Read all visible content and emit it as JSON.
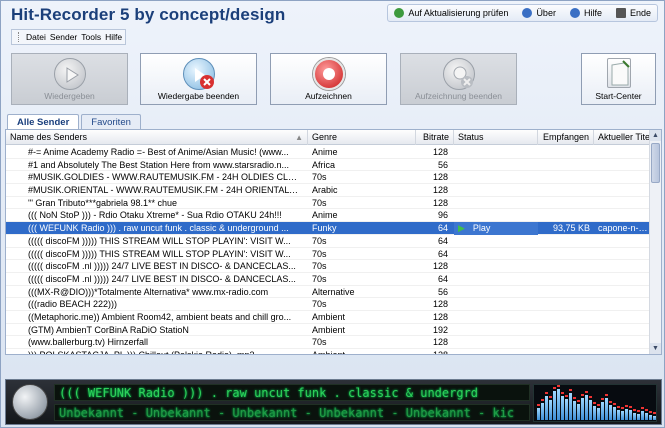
{
  "app": {
    "title": "Hit-Recorder 5 by concept/design"
  },
  "toplinks": [
    {
      "label": "Auf Aktualisierung prüfen",
      "color": "#3d9a3d"
    },
    {
      "label": "Über",
      "color": "#3a6fc4"
    },
    {
      "label": "Hilfe",
      "color": "#3a6fc4"
    },
    {
      "label": "Ende",
      "color": "#444444"
    }
  ],
  "menu": [
    "Datei",
    "Sender",
    "Tools",
    "Hilfe"
  ],
  "toolbar": {
    "play": "Wiedergeben",
    "stop_play": "Wiedergabe beenden",
    "record": "Aufzeichnen",
    "stop_record": "Aufzeichnung beenden",
    "start_center": "Start-Center"
  },
  "tabs": [
    "Alle Sender",
    "Favoriten"
  ],
  "columns": {
    "name": "Name des Senders",
    "genre": "Genre",
    "bitrate": "Bitrate",
    "status": "Status",
    "received": "Empfangen",
    "title": "Aktueller Tite"
  },
  "rows": [
    {
      "name": "#-= Anime Academy Radio =- Best of Anime/Asian Music! (www...",
      "genre": "Anime",
      "bitrate": "128",
      "status": "",
      "received": "",
      "title": ""
    },
    {
      "name": "#1 and Absolutely The Best Station Here from www.starsradio.n...",
      "genre": "Africa",
      "bitrate": "56",
      "status": "",
      "received": "",
      "title": ""
    },
    {
      "name": "#MUSIK.GOLDIES - WWW.RAUTEMUSIK.FM - 24H OLDIES CLAS...",
      "genre": "70s",
      "bitrate": "128",
      "status": "",
      "received": "",
      "title": ""
    },
    {
      "name": "#MUSIK.ORIENTAL - WWW.RAUTEMUSIK.FM - 24H ORIENTAL A...",
      "genre": "Arabic",
      "bitrate": "128",
      "status": "",
      "received": "",
      "title": ""
    },
    {
      "name": "'\" Gran Tributo***gabriela 98.1** chue",
      "genre": "70s",
      "bitrate": "128",
      "status": "",
      "received": "",
      "title": ""
    },
    {
      "name": "((( NoN StoP ))) - Rdio Otaku Xtreme* - Sua Rdio OTAKU 24h!!!",
      "genre": "Anime",
      "bitrate": "96",
      "status": "",
      "received": "",
      "title": ""
    },
    {
      "name": "((( WEFUNK Radio ))) . raw uncut funk . classic & underground ...",
      "genre": "Funky",
      "bitrate": "64",
      "status": "Play",
      "received": "93,75 KB",
      "title": "capone-n-nore",
      "selected": true
    },
    {
      "name": "((((( discoFM ))))) THIS STREAM WILL STOP PLAYIN': VISIT W...",
      "genre": "70s",
      "bitrate": "64",
      "status": "",
      "received": "",
      "title": ""
    },
    {
      "name": "((((( discoFM ))))) THIS STREAM WILL STOP PLAYIN': VISIT W...",
      "genre": "70s",
      "bitrate": "64",
      "status": "",
      "received": "",
      "title": ""
    },
    {
      "name": "((((( discoFM .nl ))))) 24/7 LIVE BEST IN DISCO- & DANCECLAS...",
      "genre": "70s",
      "bitrate": "128",
      "status": "",
      "received": "",
      "title": ""
    },
    {
      "name": "((((( discoFM .nl ))))) 24/7 LIVE BEST IN DISCO- & DANCECLAS...",
      "genre": "70s",
      "bitrate": "64",
      "status": "",
      "received": "",
      "title": ""
    },
    {
      "name": "(((MX-R@DIO)))*Totalmente Alternativa* www.mx-radio.com",
      "genre": "Alternative",
      "bitrate": "56",
      "status": "",
      "received": "",
      "title": ""
    },
    {
      "name": "(((radio BEACH 222)))",
      "genre": "70s",
      "bitrate": "128",
      "status": "",
      "received": "",
      "title": ""
    },
    {
      "name": "((Metaphoric.me)) Ambient Room42, ambient beats and chill gro...",
      "genre": "Ambient",
      "bitrate": "128",
      "status": "",
      "received": "",
      "title": ""
    },
    {
      "name": "(GTM) AmbienT CorBinA RaDiO StatioN",
      "genre": "Ambient",
      "bitrate": "192",
      "status": "",
      "received": "",
      "title": ""
    },
    {
      "name": "(www.ballerburg.tv) Hirnzerfall",
      "genre": "70s",
      "bitrate": "128",
      "status": "",
      "received": "",
      "title": ""
    },
    {
      "name": "))) POLSKASTACJA .PL ))) Chillout (Polskie Radio) .mp3",
      "genre": "Ambient",
      "bitrate": "128",
      "status": "",
      "received": "",
      "title": ""
    }
  ],
  "player": {
    "line1": "((( WEFUNK Radio ))) . raw uncut funk . classic & undergrd",
    "line2": "Unbekannt - Unbekannt - Unbekannt - Unbekannt - Unbekannt - kic"
  },
  "spectrum_levels": [
    0.35,
    0.5,
    0.72,
    0.6,
    0.85,
    0.9,
    0.7,
    0.62,
    0.8,
    0.55,
    0.48,
    0.66,
    0.74,
    0.58,
    0.42,
    0.36,
    0.52,
    0.64,
    0.45,
    0.38,
    0.3,
    0.25,
    0.33,
    0.28,
    0.22,
    0.18,
    0.26,
    0.2,
    0.16,
    0.12
  ]
}
